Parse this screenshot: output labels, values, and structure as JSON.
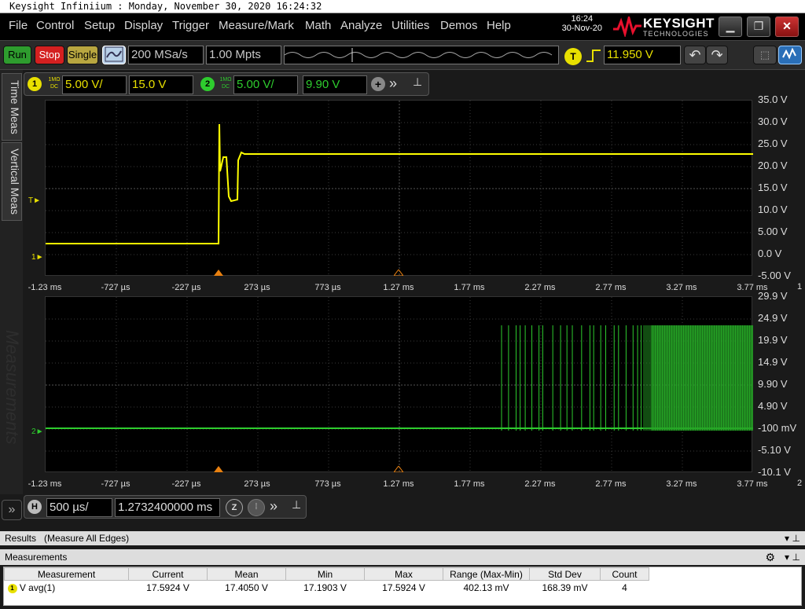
{
  "title": "Keysight Infiniium : Monday, November 30, 2020 16:24:32",
  "menu": [
    "File",
    "Control",
    "Setup",
    "Display",
    "Trigger",
    "Measure/Mark",
    "Math",
    "Analyze",
    "Utilities",
    "Demos",
    "Help"
  ],
  "clock": {
    "time": "16:24",
    "date": "30-Nov-20"
  },
  "brand": {
    "name": "KEYSIGHT",
    "sub": "TECHNOLOGIES"
  },
  "toolbar": {
    "run": "Run",
    "stop": "Stop",
    "single": "Single",
    "sample_rate": "200 MSa/s",
    "memory_depth": "1.00 Mpts",
    "trigger_badge": "T",
    "trigger_level": "11.950 V"
  },
  "channel1": {
    "num": "1",
    "coupling": "1MΩ DC",
    "scale": "5.00 V/",
    "offset": "15.0 V"
  },
  "channel2": {
    "num": "2",
    "coupling": "1MΩ DC",
    "scale": "5.00 V/",
    "offset": "9.90 V"
  },
  "sidetabs": {
    "time": "Time Meas",
    "vertical": "Vertical Meas",
    "watermark": "Measurements"
  },
  "plot1": {
    "ylabels": [
      "35.0 V",
      "30.0 V",
      "25.0 V",
      "20.0 V",
      "15.0 V",
      "10.0 V",
      "5.00 V",
      "0.0 V",
      "-5.00 V"
    ],
    "xlabels": [
      "-1.23 ms",
      "-727 µs",
      "-227 µs",
      "273 µs",
      "773 µs",
      "1.27 ms",
      "1.77 ms",
      "2.27 ms",
      "2.77 ms",
      "3.27 ms",
      "3.77 ms"
    ],
    "marker": "1",
    "trig_marker": "T"
  },
  "plot2": {
    "ylabels": [
      "29.9 V",
      "24.9 V",
      "19.9 V",
      "14.9 V",
      "9.90 V",
      "4.90 V",
      "-100 mV",
      "-5.10 V",
      "-10.1 V"
    ],
    "xlabels": [
      "-1.23 ms",
      "-727 µs",
      "-227 µs",
      "273 µs",
      "773 µs",
      "1.27 ms",
      "1.77 ms",
      "2.27 ms",
      "2.77 ms",
      "3.27 ms",
      "3.77 ms"
    ],
    "marker": "2"
  },
  "horizontal": {
    "badge": "H",
    "scale": "500 µs/",
    "position": "1.2732400000 ms",
    "zoom": "Z"
  },
  "results": {
    "label": "Results",
    "mode": "(Measure All Edges)"
  },
  "measurements": {
    "label": "Measurements",
    "headers": [
      "Measurement",
      "Current",
      "Mean",
      "Min",
      "Max",
      "Range (Max-Min)",
      "Std Dev",
      "Count"
    ],
    "rows": [
      {
        "badge": "1",
        "name": "V avg(1)",
        "current": "17.5924 V",
        "mean": "17.4050 V",
        "min": "17.1903 V",
        "max": "17.5924 V",
        "range": "402.13 mV",
        "std": "168.39 mV",
        "count": "4"
      }
    ]
  },
  "colors": {
    "ch1": "#ffff00",
    "ch2": "#2ecc2e",
    "accent": "#e8e8e8"
  }
}
